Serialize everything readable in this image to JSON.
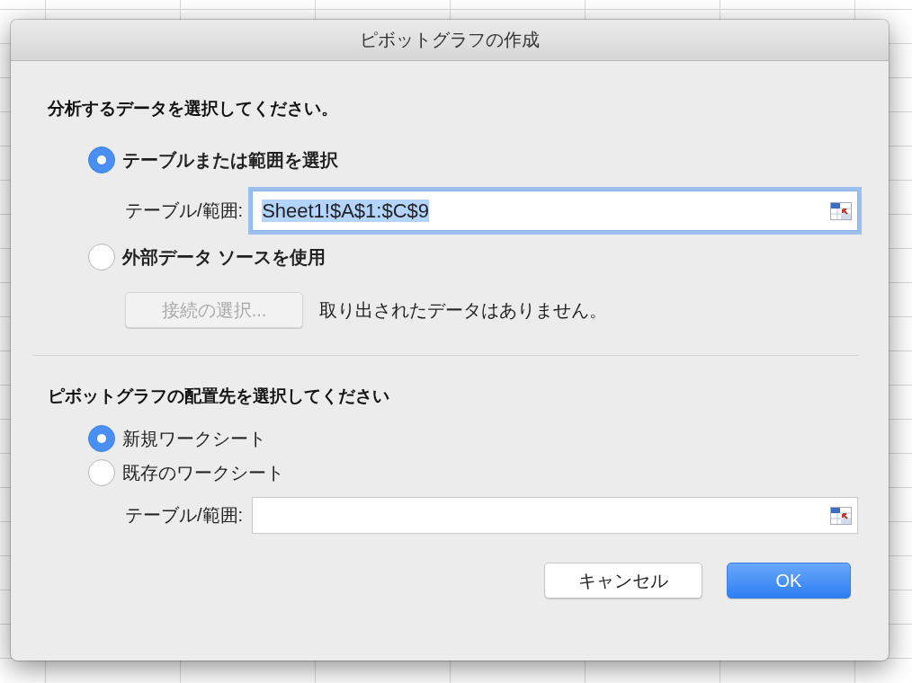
{
  "window": {
    "title": "ピボットグラフの作成"
  },
  "source": {
    "heading": "分析するデータを選択してください。",
    "options": [
      {
        "label": "テーブルまたは範囲を選択",
        "selected": true
      },
      {
        "label": "外部データ ソースを使用",
        "selected": false
      }
    ],
    "range_field": {
      "label": "テーブル/範囲:",
      "value": "Sheet1!$A$1:$C$9",
      "focused": true
    },
    "connection_button": {
      "label": "接続の選択...",
      "disabled": true
    },
    "connection_note": "取り出されたデータはありません。"
  },
  "destination": {
    "heading": "ピボットグラフの配置先を選択してください",
    "options": [
      {
        "label": "新規ワークシート",
        "selected": true
      },
      {
        "label": "既存のワークシート",
        "selected": false
      }
    ],
    "range_field": {
      "label": "テーブル/範囲:",
      "focused": false
    }
  },
  "buttons": [
    {
      "label": "キャンセル",
      "kind": "cancel"
    },
    {
      "label": "OK",
      "kind": "default"
    }
  ]
}
